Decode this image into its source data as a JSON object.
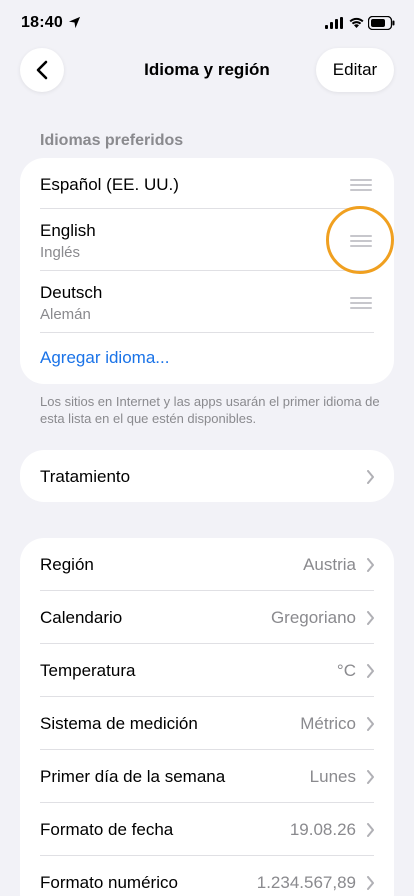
{
  "status": {
    "time": "18:40"
  },
  "nav": {
    "title": "Idioma y región",
    "edit": "Editar"
  },
  "languages": {
    "header": "Idiomas preferidos",
    "items": [
      {
        "title": "Español (EE. UU.)",
        "subtitle": ""
      },
      {
        "title": "English",
        "subtitle": "Inglés"
      },
      {
        "title": "Deutsch",
        "subtitle": "Alemán"
      }
    ],
    "add": "Agregar idioma...",
    "footnote": "Los sitios en Internet y las apps usarán el primer idioma de esta lista en el que estén disponibles."
  },
  "treatment": {
    "label": "Tratamiento"
  },
  "settings": [
    {
      "label": "Región",
      "value": "Austria"
    },
    {
      "label": "Calendario",
      "value": "Gregoriano"
    },
    {
      "label": "Temperatura",
      "value": "°C"
    },
    {
      "label": "Sistema de medición",
      "value": "Métrico"
    },
    {
      "label": "Primer día de la semana",
      "value": "Lunes"
    },
    {
      "label": "Formato de fecha",
      "value": "19.08.26"
    },
    {
      "label": "Formato numérico",
      "value": "1.234.567,89"
    }
  ],
  "colors": {
    "accent": "#1a73e8",
    "highlight": "#f0a020",
    "background": "#f2f2f7"
  }
}
